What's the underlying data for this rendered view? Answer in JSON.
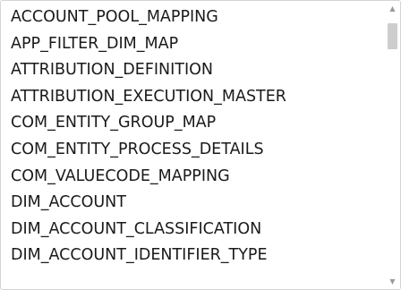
{
  "list": {
    "items": [
      "ACCOUNT_POOL_MAPPING",
      "APP_FILTER_DIM_MAP",
      "ATTRIBUTION_DEFINITION",
      "ATTRIBUTION_EXECUTION_MASTER",
      "COM_ENTITY_GROUP_MAP",
      "COM_ENTITY_PROCESS_DETAILS",
      "COM_VALUECODE_MAPPING",
      "DIM_ACCOUNT",
      "DIM_ACCOUNT_CLASSIFICATION",
      "DIM_ACCOUNT_IDENTIFIER_TYPE"
    ]
  },
  "scrollbar": {
    "up_icon": "triangle-up-icon",
    "down_icon": "triangle-down-icon",
    "thumb_position_fraction": 0.03,
    "thumb_size_fraction": 0.1
  }
}
